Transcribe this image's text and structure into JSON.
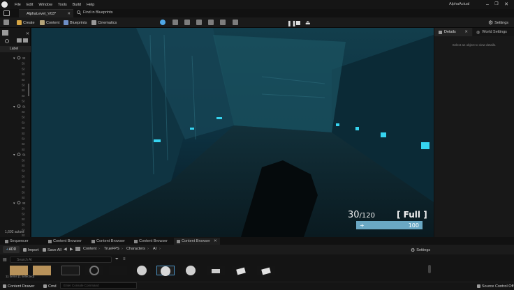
{
  "menu": {
    "items": [
      "File",
      "Edit",
      "Window",
      "Tools",
      "Build",
      "Help"
    ],
    "project_name": "AlphaActual"
  },
  "tabs": {
    "level_tab": "AlphaLevel_V03*",
    "find_in_blueprints": "Find in Blueprints"
  },
  "toolbar": {
    "create": "Create",
    "content": "Content",
    "blueprints": "Blueprints",
    "cinematics": "Cinematics",
    "settings": "Settings"
  },
  "outliner": {
    "label_header": "Label",
    "row_text": "St",
    "actor_count": "1,692 actors"
  },
  "details": {
    "tab_details": "Details",
    "tab_world_settings": "World Settings",
    "empty_message": "Select an object to view details."
  },
  "hud": {
    "ammo_current": "30",
    "ammo_reserve": "/120",
    "mag_status": "[ Full ]",
    "health_symbol": "+",
    "health_value": "100"
  },
  "bottom_tabs": {
    "sequencer": "Sequencer",
    "content_browser_1": "Content Browser",
    "content_browser_2": "Content Browser",
    "content_browser_3": "Content Browser",
    "content_browser_4": "Content Browser"
  },
  "content_browser": {
    "add": "ADD",
    "import": "Import",
    "save_all": "Save All",
    "breadcrumbs": [
      "Content",
      "TrueFPS",
      "Characters",
      "AI"
    ],
    "settings": "Settings",
    "search_placeholder": "Search AI",
    "items_info": "11 items (1 selected)"
  },
  "status": {
    "content_drawer": "Content Drawer",
    "cmd": "Cmd",
    "console_placeholder": "Enter Console Command",
    "source_control": "Source Control Off"
  }
}
